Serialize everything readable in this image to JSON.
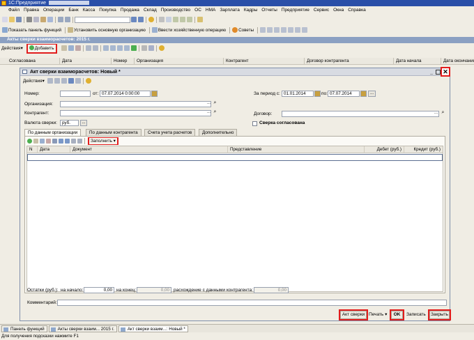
{
  "app": {
    "title": "1С:Предприятие"
  },
  "menu": [
    "Файл",
    "Правка",
    "Операции",
    "Банк",
    "Касса",
    "Покупка",
    "Продажа",
    "Склад",
    "Производство",
    "ОС",
    "НМА",
    "Зарплата",
    "Кадры",
    "Отчеты",
    "Предприятие",
    "Сервис",
    "Окна",
    "Справка"
  ],
  "toolbar2": {
    "show_panel": "Показать панель функций",
    "set_org": "Установить основную организацию",
    "enter_op": "Ввести хозяйственную операцию",
    "tips": "Советы"
  },
  "list_window": {
    "title": "Акты сверки взаиморасчетов: 2015 г.",
    "actions": "Действия",
    "add": "Добавить",
    "columns": [
      "Согласована",
      "Дата",
      "Номер",
      "Организация",
      "Контрагент",
      "Договор контрагента",
      "Дата начала",
      "Дата окончания"
    ]
  },
  "form": {
    "title": "Акт сверки взаиморасчетов: Новый *",
    "actions": "Действия",
    "number_label": "Номер:",
    "number_value": "",
    "from_label": "от:",
    "date_value": "07.07.2014  0:00:00",
    "period_label": "За период с:",
    "period_from": "01.01.2014",
    "period_to_label": "по:",
    "period_to": "07.07.2014",
    "org_label": "Организация:",
    "org_value": "",
    "contractor_label": "Контрагент:",
    "contractor_value": "",
    "contract_label": "Договор:",
    "contract_value": "",
    "currency_label": "Валюта сверки:",
    "currency_value": "руб.",
    "agreed_label": "Сверка согласована",
    "tabs": [
      "По данным организации",
      "По данным контрагента",
      "Счета учета расчетов",
      "Дополнительно"
    ],
    "fill": "Заполнить",
    "table_headers": [
      "N",
      "Дата",
      "Документ",
      "Представление",
      "Дебет (руб.)",
      "Кредит (руб.)"
    ],
    "balances_label": "Остатки (руб.):",
    "start_label": "на начало:",
    "start_value": "0,00",
    "end_label": "на конец:",
    "end_value": "0,00",
    "diff_label": "расхождение с данными контрагента:",
    "diff_value": "0,00",
    "comment_label": "Комментарий:",
    "comment_value": "",
    "buttons": {
      "act": "Акт сверки",
      "print": "Печать",
      "ok": "OK",
      "save": "Записать",
      "close": "Закрыть"
    }
  },
  "taskbar": [
    "Панель функций",
    "Акты сверки взаим... 2015 г.",
    "Акт сверки взаим...: Новый *"
  ],
  "status_hint": "Для получения подсказки нажмите F1",
  "colors": {
    "highlight": "#e21d1d",
    "title_blue": "#2a4fa8",
    "panel_bg": "#f0ede4"
  }
}
